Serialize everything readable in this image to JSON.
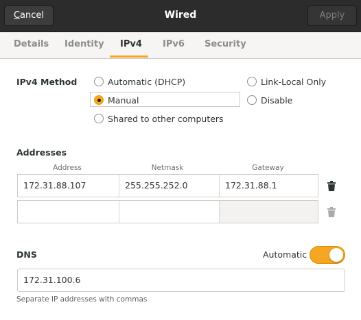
{
  "window": {
    "title": "Wired",
    "cancel_mnemonic": "C",
    "cancel_rest": "ancel",
    "apply_label": "Apply"
  },
  "tabs": [
    {
      "label": "Details",
      "active": false
    },
    {
      "label": "Identity",
      "active": false
    },
    {
      "label": "IPv4",
      "active": true
    },
    {
      "label": "IPv6",
      "active": false
    },
    {
      "label": "Security",
      "active": false
    }
  ],
  "ipv4": {
    "method_label": "IPv4 Method",
    "methods": [
      {
        "label": "Automatic (DHCP)",
        "selected": false
      },
      {
        "label": "Link-Local Only",
        "selected": false
      },
      {
        "label": "Manual",
        "selected": true
      },
      {
        "label": "Disable",
        "selected": false
      },
      {
        "label": "Shared to other computers",
        "selected": false
      }
    ]
  },
  "addresses": {
    "title": "Addresses",
    "columns": [
      "Address",
      "Netmask",
      "Gateway"
    ],
    "rows": [
      [
        "172.31.88.107",
        "255.255.252.0",
        "172.31.88.1"
      ],
      [
        "",
        "",
        ""
      ]
    ]
  },
  "dns": {
    "title": "DNS",
    "automatic_label": "Automatic",
    "automatic_on": true,
    "value": "172.31.100.6",
    "hint": "Separate IP addresses with commas"
  },
  "colors": {
    "accent": "#f5a623",
    "header_bg": "#2c2c2c"
  },
  "icons": [
    "trash-icon",
    "trash-icon"
  ]
}
